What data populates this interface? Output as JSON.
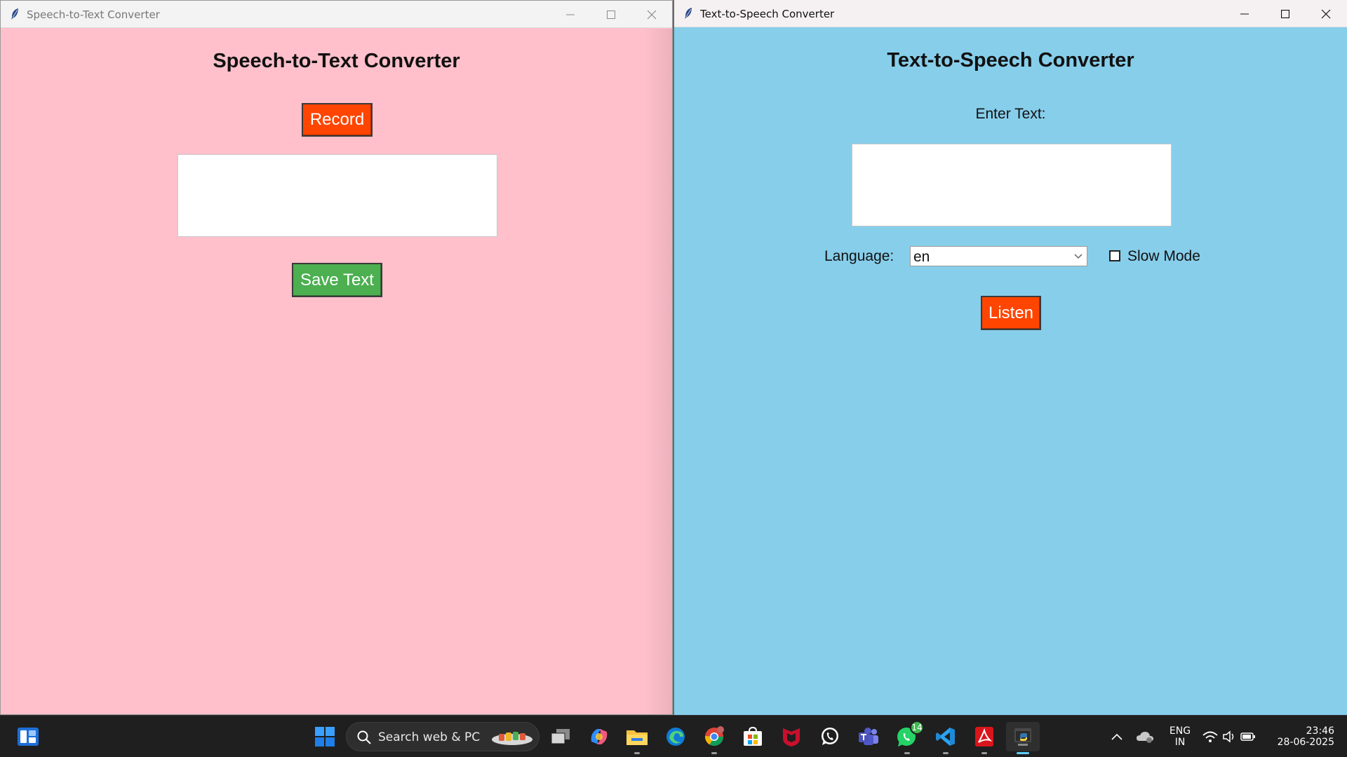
{
  "left_window": {
    "title": "Speech-to-Text Converter",
    "heading": "Speech-to-Text Converter",
    "record_label": "Record",
    "save_label": "Save Text",
    "text_value": "",
    "bg_color": "#ffc0cb"
  },
  "right_window": {
    "title": "Text-to-Speech Converter",
    "heading": "Text-to-Speech Converter",
    "enter_text_label": "Enter Text:",
    "text_value": "",
    "language_label": "Language:",
    "language_value": "en",
    "slow_mode_label": "Slow Mode",
    "slow_mode_checked": false,
    "listen_label": "Listen",
    "bg_color": "#87ceeb"
  },
  "colors": {
    "record_button": "#ff4500",
    "save_button": "#4caf50",
    "listen_button": "#ff4500"
  },
  "taskbar": {
    "search_label": "Search web & PC",
    "whatsapp_badge": "14",
    "pinned_apps": [
      "widgets-icon",
      "start-icon",
      "search-icon",
      "task-view-icon",
      "copilot-icon",
      "file-explorer-icon",
      "edge-icon",
      "chrome-icon",
      "ms-store-icon",
      "mcafee-icon",
      "whatsapp-icon",
      "teams-icon",
      "whatsapp-business-icon",
      "vscode-icon",
      "acrobat-icon",
      "python-icon"
    ],
    "language_line1": "ENG",
    "language_line2": "IN",
    "time": "23:46",
    "date": "28-06-2025"
  }
}
